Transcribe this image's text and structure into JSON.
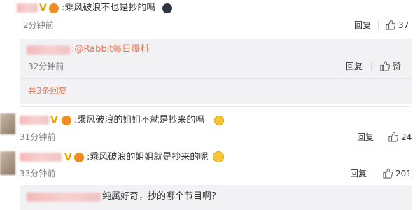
{
  "comments": [
    {
      "text": "乘风破浪不也是抄的吗",
      "time": "2分钟前",
      "reply_label": "回复",
      "likes": "37",
      "replies": [
        {
          "text": ":@Rabbit每日爆料",
          "time": "32分钟前",
          "reply_label": "回复",
          "like_label": "赞"
        }
      ],
      "more_replies_label": "共3条回复"
    },
    {
      "text": "乘风破浪的姐姐不就是抄来的吗",
      "time": "31分钟前",
      "reply_label": "回复",
      "likes": "24"
    },
    {
      "text": "乘风破浪的姐姐就是抄来的呢",
      "time": "33分钟前",
      "reply_label": "回复",
      "likes": "201"
    },
    {
      "text": "纯属好奇，抄的哪个节目啊？"
    }
  ],
  "badge_glyph": "V",
  "icons": [
    "thumbs-up-icon",
    "emoji-icon",
    "vip-badge-icon"
  ],
  "colors": {
    "accent": "#eb7350",
    "badge": "#f0a000",
    "muted": "#808080",
    "reply_bg": "#f2f2f5"
  }
}
